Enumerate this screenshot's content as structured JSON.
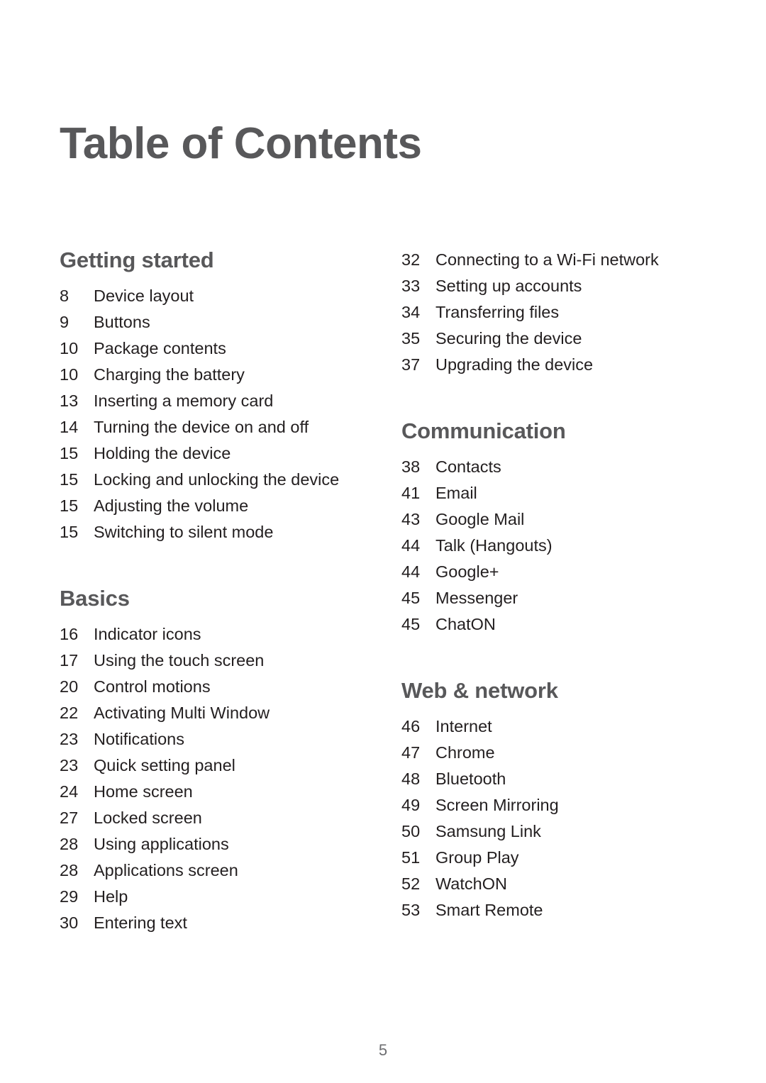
{
  "document": {
    "title": "Table of Contents",
    "folio": "5",
    "colors": {
      "heading": "#58585a",
      "body": "#231f20",
      "folio": "#6d6e71",
      "background": "#ffffff"
    }
  },
  "columns": [
    {
      "name": "left",
      "sections": [
        {
          "heading": "Getting started",
          "entries": [
            {
              "page": "8",
              "label": "Device layout"
            },
            {
              "page": "9",
              "label": "Buttons"
            },
            {
              "page": "10",
              "label": "Package contents"
            },
            {
              "page": "10",
              "label": "Charging the battery"
            },
            {
              "page": "13",
              "label": "Inserting a memory card"
            },
            {
              "page": "14",
              "label": "Turning the device on and off"
            },
            {
              "page": "15",
              "label": "Holding the device"
            },
            {
              "page": "15",
              "label": "Locking and unlocking the device"
            },
            {
              "page": "15",
              "label": "Adjusting the volume"
            },
            {
              "page": "15",
              "label": "Switching to silent mode"
            }
          ]
        },
        {
          "heading": "Basics",
          "entries": [
            {
              "page": "16",
              "label": "Indicator icons"
            },
            {
              "page": "17",
              "label": "Using the touch screen"
            },
            {
              "page": "20",
              "label": "Control motions"
            },
            {
              "page": "22",
              "label": "Activating Multi Window"
            },
            {
              "page": "23",
              "label": "Notifications"
            },
            {
              "page": "23",
              "label": "Quick setting panel"
            },
            {
              "page": "24",
              "label": "Home screen"
            },
            {
              "page": "27",
              "label": "Locked screen"
            },
            {
              "page": "28",
              "label": "Using applications"
            },
            {
              "page": "28",
              "label": "Applications screen"
            },
            {
              "page": "29",
              "label": "Help"
            },
            {
              "page": "30",
              "label": "Entering text"
            }
          ]
        }
      ]
    },
    {
      "name": "right",
      "sections": [
        {
          "heading": "",
          "entries": [
            {
              "page": "32",
              "label": "Connecting to a Wi-Fi network"
            },
            {
              "page": "33",
              "label": "Setting up accounts"
            },
            {
              "page": "34",
              "label": "Transferring files"
            },
            {
              "page": "35",
              "label": "Securing the device"
            },
            {
              "page": "37",
              "label": "Upgrading the device"
            }
          ]
        },
        {
          "heading": "Communication",
          "entries": [
            {
              "page": "38",
              "label": "Contacts"
            },
            {
              "page": "41",
              "label": "Email"
            },
            {
              "page": "43",
              "label": "Google Mail"
            },
            {
              "page": "44",
              "label": "Talk (Hangouts)"
            },
            {
              "page": "44",
              "label": "Google+"
            },
            {
              "page": "45",
              "label": "Messenger"
            },
            {
              "page": "45",
              "label": "ChatON"
            }
          ]
        },
        {
          "heading": "Web & network",
          "entries": [
            {
              "page": "46",
              "label": "Internet"
            },
            {
              "page": "47",
              "label": "Chrome"
            },
            {
              "page": "48",
              "label": "Bluetooth"
            },
            {
              "page": "49",
              "label": "Screen Mirroring"
            },
            {
              "page": "50",
              "label": "Samsung Link"
            },
            {
              "page": "51",
              "label": "Group Play"
            },
            {
              "page": "52",
              "label": "WatchON"
            },
            {
              "page": "53",
              "label": "Smart Remote"
            }
          ]
        }
      ]
    }
  ]
}
